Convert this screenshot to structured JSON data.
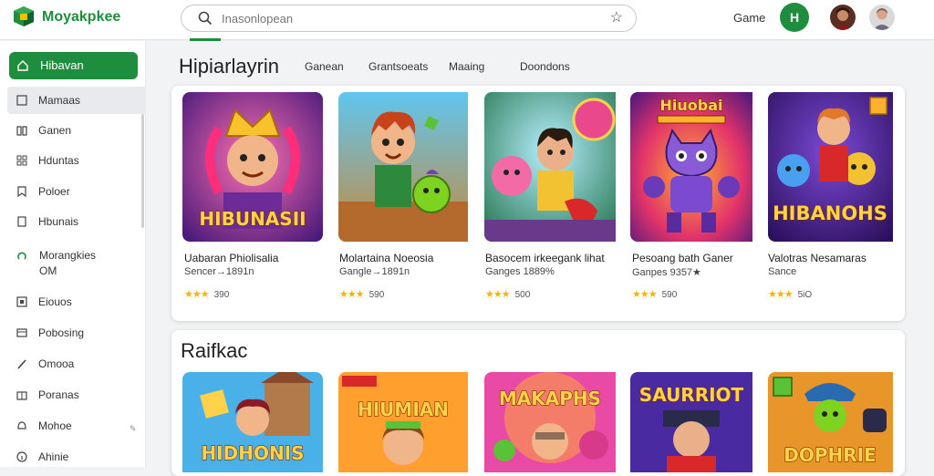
{
  "app": {
    "brand": "Moyakpkee",
    "search_placeholder": "Inasonlopean",
    "top_link": "Game",
    "account_initial": "H",
    "colors": {
      "accent": "#1e8e3e",
      "rating": "#f4b400"
    }
  },
  "sidebar": {
    "home": "Hibavan",
    "items": [
      {
        "label": "Mamaas",
        "icon": "grid-icon"
      },
      {
        "label": "Ganen",
        "icon": "book-icon"
      },
      {
        "label": "Hduntas",
        "icon": "apps-icon"
      },
      {
        "label": "Poloer",
        "icon": "bookmark-icon"
      },
      {
        "label": "Hbunais",
        "icon": "tag-icon"
      },
      {
        "label_line1": "Morangkies",
        "label_line2": "OM",
        "icon": "cloud-icon"
      },
      {
        "label": "Eiouos",
        "icon": "box-icon"
      },
      {
        "label": "Pobosing",
        "icon": "payment-icon"
      },
      {
        "label": "Omooa",
        "icon": "pen-icon"
      },
      {
        "label": "Poranas",
        "icon": "gift-icon"
      },
      {
        "label": "Mohoe",
        "icon": "bell-icon"
      },
      {
        "label": "Ahinie",
        "icon": "info-icon"
      }
    ]
  },
  "main": {
    "section1_title": "Hipiarlayrin",
    "tabs": [
      "Ganean",
      "Grantsoeats",
      "Maaing",
      "Doondons"
    ],
    "section2_title": "Raifkac",
    "cards": [
      {
        "title": "Uabaran Phiolisalia",
        "sub": "Sencer→1891n",
        "rating": "390",
        "art_text": "HIBUNASII"
      },
      {
        "title": "Molartaina Noeosia",
        "sub": "Gangle→1891n",
        "rating": "590",
        "art_text": ""
      },
      {
        "title": "Basocem irkeegank lihat",
        "sub": "Ganges 1889%",
        "rating": "500",
        "art_text": ""
      },
      {
        "title": "Pesoang bath Ganer",
        "sub": "Ganpes 9357★",
        "rating": "590",
        "art_text": "Hiuobai"
      },
      {
        "title": "Valotras Nesamaras",
        "sub": "Sance",
        "rating": "5iO",
        "art_text": "HIBANOHS"
      }
    ],
    "cards2": [
      {
        "art_text": "HIDHONIS"
      },
      {
        "art_text": "HIUMIAN"
      },
      {
        "art_text": "MAKAPHS"
      },
      {
        "art_text": "SAURRIOT"
      },
      {
        "art_text": "DOPHRIE"
      }
    ]
  }
}
